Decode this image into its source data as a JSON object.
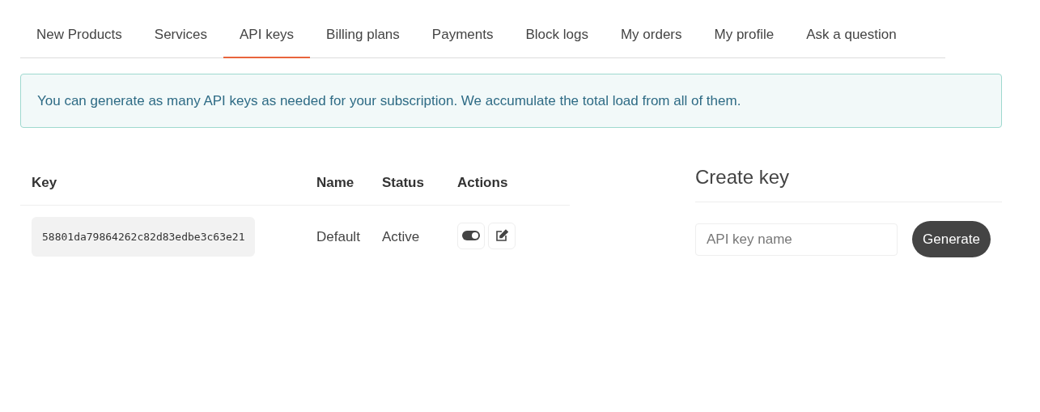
{
  "tabs": [
    {
      "label": "New Products",
      "selected": false
    },
    {
      "label": "Services",
      "selected": false
    },
    {
      "label": "API keys",
      "selected": true
    },
    {
      "label": "Billing plans",
      "selected": false
    },
    {
      "label": "Payments",
      "selected": false
    },
    {
      "label": "Block logs",
      "selected": false
    },
    {
      "label": "My orders",
      "selected": false
    },
    {
      "label": "My profile",
      "selected": false
    },
    {
      "label": "Ask a question",
      "selected": false
    }
  ],
  "notice": "You can generate as many API keys as needed for your subscription. We accumulate the total load from all of them.",
  "table": {
    "columns": [
      "Key",
      "Name",
      "Status",
      "Actions"
    ],
    "rows": [
      {
        "key": "58801da79864262c82d83edbe3c63e21",
        "name": "Default",
        "status": "Active"
      }
    ]
  },
  "create_key": {
    "title": "Create key",
    "placeholder": "API key name",
    "button": "Generate"
  }
}
